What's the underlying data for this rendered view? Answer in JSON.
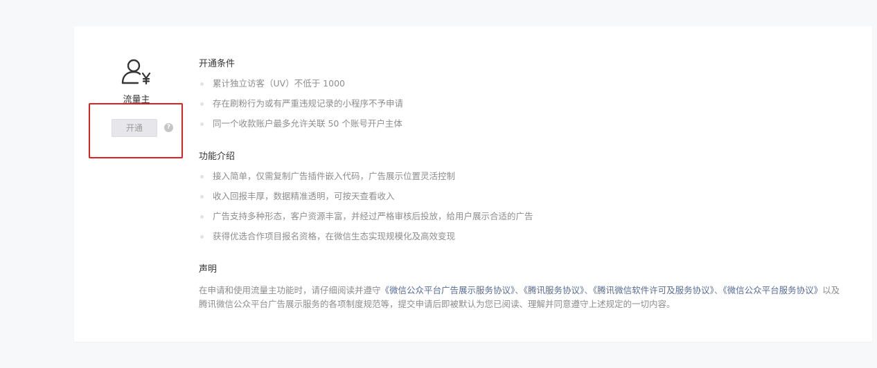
{
  "role": {
    "name": "流量主",
    "open_label": "开通",
    "help_glyph": "?",
    "icon": "user-yen-icon"
  },
  "sections": {
    "conditions": {
      "title": "开通条件",
      "items": [
        "累计独立访客（UV）不低于 1000",
        "存在刷粉行为或有严重违规记录的小程序不予申请",
        "同一个收款账户最多允许关联 50 个账号开户主体"
      ]
    },
    "features": {
      "title": "功能介绍",
      "items": [
        "接入简单，仅需复制广告插件嵌入代码，广告展示位置灵活控制",
        "收入回报丰厚，数据精准透明，可按天查看收入",
        "广告支持多种形态，客户资源丰富，并经过严格审核后投放，给用户展示合适的广告",
        "获得优选合作项目报名资格，在微信生态实现规模化及高效变现"
      ]
    },
    "statement": {
      "title": "声明",
      "text_prefix": "在申请和使用流量主功能时，请仔细阅读并遵守",
      "link_1": "《微信公众平台广告展示服务协议》",
      "sep_1": "、",
      "link_2": "《腾讯服务协议》",
      "sep_2": "、",
      "link_3": "《腾讯微信软件许可及服务协议》",
      "sep_3": "、",
      "link_4": "《微信公众平台服务协议》",
      "text_suffix": "以及腾讯微信公众平台广告展示服务的各项制度规范等，提交申请后即被默认为您已阅读、理解并同意遵守上述规定的一切内容。"
    }
  },
  "colors": {
    "link": "#576b95",
    "highlight": "#e02020",
    "muted_text": "#8d8d8d"
  }
}
